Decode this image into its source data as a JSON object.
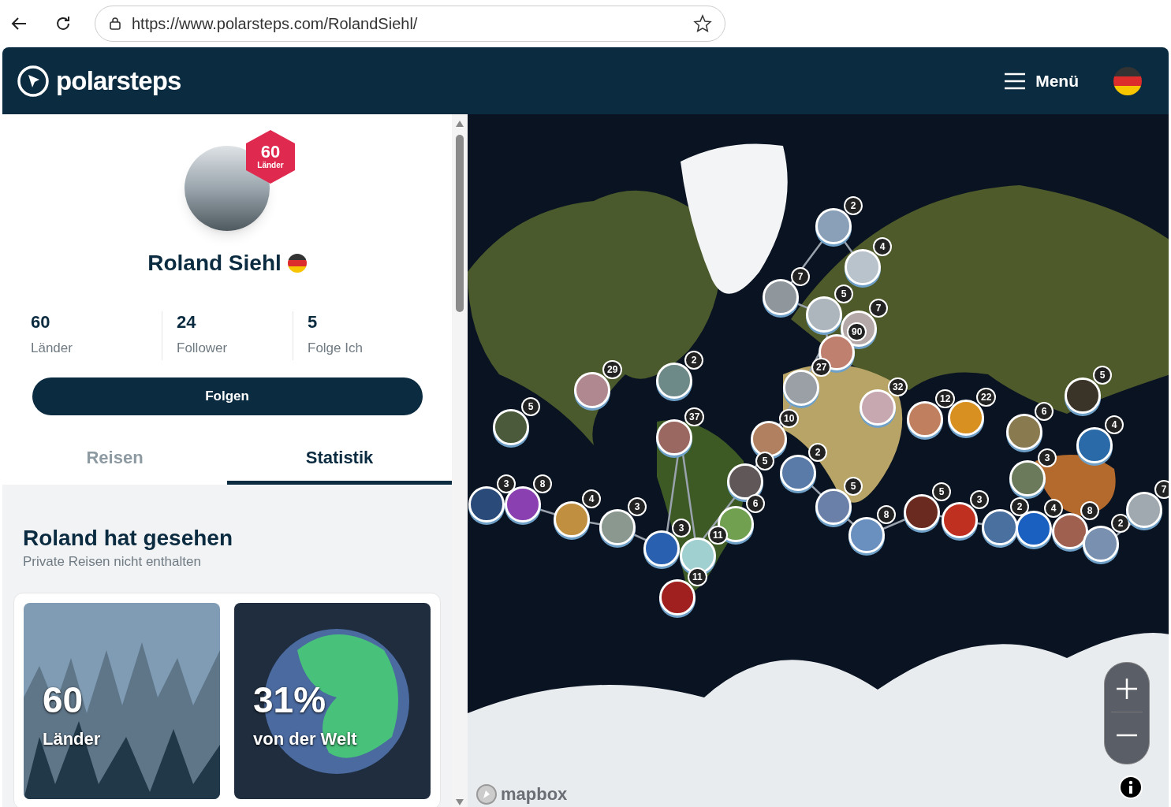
{
  "browser": {
    "url": "https://www.polarsteps.com/RolandSiehl/"
  },
  "header": {
    "logo": "polarsteps",
    "menu": "Menü"
  },
  "profile": {
    "badge_number": "60",
    "badge_label": "Länder",
    "name": "Roland Siehl",
    "stats": [
      {
        "value": "60",
        "label": "Länder"
      },
      {
        "value": "24",
        "label": "Follower"
      },
      {
        "value": "5",
        "label": "Folge Ich"
      }
    ],
    "follow_button": "Folgen"
  },
  "tabs": [
    {
      "label": "Reisen",
      "selected": false
    },
    {
      "label": "Statistik",
      "selected": true
    }
  ],
  "seen": {
    "title": "Roland hat gesehen",
    "subtitle": "Private Reisen nicht enthalten",
    "cards": [
      {
        "kind": "mountains",
        "value": "60",
        "label": "Länder"
      },
      {
        "kind": "globe",
        "value": "31%",
        "label": "von der Welt"
      }
    ]
  },
  "map": {
    "attribution": "mapbox",
    "markers": [
      {
        "count": "2"
      },
      {
        "count": "4"
      },
      {
        "count": "7"
      },
      {
        "count": "5"
      },
      {
        "count": "7"
      },
      {
        "count": "90"
      },
      {
        "count": "27"
      },
      {
        "count": "29"
      },
      {
        "count": "2"
      },
      {
        "count": "5"
      },
      {
        "count": "37"
      },
      {
        "count": "10"
      },
      {
        "count": "32"
      },
      {
        "count": "12"
      },
      {
        "count": "22"
      },
      {
        "count": "6"
      },
      {
        "count": "5"
      },
      {
        "count": "4"
      },
      {
        "count": "5"
      },
      {
        "count": "2"
      },
      {
        "count": "3"
      },
      {
        "count": "3"
      },
      {
        "count": "8"
      },
      {
        "count": "4"
      },
      {
        "count": "3"
      },
      {
        "count": "6"
      },
      {
        "count": "3"
      },
      {
        "count": "11"
      },
      {
        "count": "11"
      },
      {
        "count": "5"
      },
      {
        "count": "8"
      },
      {
        "count": "5"
      },
      {
        "count": "3"
      },
      {
        "count": "2"
      },
      {
        "count": "4"
      },
      {
        "count": "8"
      },
      {
        "count": "2"
      },
      {
        "count": "7"
      }
    ]
  }
}
